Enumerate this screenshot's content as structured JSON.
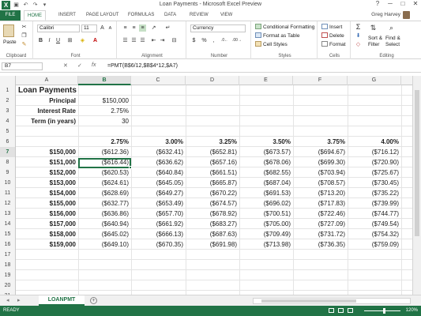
{
  "window": {
    "title": "Loan Payments - Microsoft Excel Preview",
    "user": "Greg Harvey",
    "controls": [
      "?",
      "─",
      "□",
      "✕"
    ]
  },
  "qat": {
    "logo": "X",
    "icons": [
      "save-icon",
      "undo-icon",
      "redo-icon",
      "customize-icon"
    ],
    "glyphs": [
      "▣",
      "↶",
      "↷",
      "▾"
    ]
  },
  "tabs": [
    "FILE",
    "HOME",
    "INSERT",
    "PAGE LAYOUT",
    "FORMULAS",
    "DATA",
    "REVIEW",
    "VIEW"
  ],
  "ribbon": {
    "clipboard": {
      "label": "Clipboard",
      "paste": "Paste"
    },
    "font": {
      "label": "Font",
      "name": "Calibri",
      "size": "11",
      "grow": "A",
      "shrink": "A",
      "bold": "B",
      "italic": "I",
      "underline": "U"
    },
    "alignment": {
      "label": "Alignment"
    },
    "number": {
      "label": "Number",
      "format": "Currency",
      "dollar": "$",
      "percent": "%",
      "comma": ","
    },
    "styles": {
      "label": "Styles",
      "items": [
        "Conditional Formatting",
        "Format as Table",
        "Cell Styles"
      ]
    },
    "cells": {
      "label": "Cells",
      "items": [
        "Insert",
        "Delete",
        "Format"
      ]
    },
    "editing": {
      "label": "Editing",
      "sort": "Sort &",
      "filter": "Filter",
      "find": "Find &",
      "select": "Select"
    }
  },
  "formula_bar": {
    "name_box": "B7",
    "cancel": "✕",
    "enter": "✓",
    "fx": "fx",
    "formula": "=PMT(B$6/12,$B$4*12,$A7)"
  },
  "columns": [
    "A",
    "B",
    "C",
    "D",
    "E",
    "F",
    "G"
  ],
  "row_numbers": [
    "1",
    "2",
    "3",
    "4",
    "5",
    "6",
    "7",
    "8",
    "9",
    "10",
    "11",
    "12",
    "13",
    "14",
    "15",
    "16",
    "17",
    "18",
    "19",
    "20",
    "21"
  ],
  "sheet": {
    "title": "Loan Payments",
    "inputs": [
      {
        "label": "Principal",
        "value": "$150,000"
      },
      {
        "label": "Interest Rate",
        "value": "2.75%"
      },
      {
        "label": "Term (in years)",
        "value": "30"
      }
    ],
    "rates": [
      "2.75%",
      "3.00%",
      "3.25%",
      "3.50%",
      "3.75%",
      "4.00%"
    ],
    "table": [
      {
        "principal": "$150,000",
        "payments": [
          "($612.36)",
          "($632.41)",
          "($652.81)",
          "($673.57)",
          "($694.67)",
          "($716.12)"
        ]
      },
      {
        "principal": "$151,000",
        "payments": [
          "($616.44)",
          "($636.62)",
          "($657.16)",
          "($678.06)",
          "($699.30)",
          "($720.90)"
        ]
      },
      {
        "principal": "$152,000",
        "payments": [
          "($620.53)",
          "($640.84)",
          "($661.51)",
          "($682.55)",
          "($703.94)",
          "($725.67)"
        ]
      },
      {
        "principal": "$153,000",
        "payments": [
          "($624.61)",
          "($645.05)",
          "($665.87)",
          "($687.04)",
          "($708.57)",
          "($730.45)"
        ]
      },
      {
        "principal": "$154,000",
        "payments": [
          "($628.69)",
          "($649.27)",
          "($670.22)",
          "($691.53)",
          "($713.20)",
          "($735.22)"
        ]
      },
      {
        "principal": "$155,000",
        "payments": [
          "($632.77)",
          "($653.49)",
          "($674.57)",
          "($696.02)",
          "($717.83)",
          "($739.99)"
        ]
      },
      {
        "principal": "$156,000",
        "payments": [
          "($636.86)",
          "($657.70)",
          "($678.92)",
          "($700.51)",
          "($722.46)",
          "($744.77)"
        ]
      },
      {
        "principal": "$157,000",
        "payments": [
          "($640.94)",
          "($661.92)",
          "($683.27)",
          "($705.00)",
          "($727.09)",
          "($749.54)"
        ]
      },
      {
        "principal": "$158,000",
        "payments": [
          "($645.02)",
          "($666.13)",
          "($687.63)",
          "($709.49)",
          "($731.72)",
          "($754.32)"
        ]
      },
      {
        "principal": "$159,000",
        "payments": [
          "($649.10)",
          "($670.35)",
          "($691.98)",
          "($713.98)",
          "($736.35)",
          "($759.09)"
        ]
      }
    ]
  },
  "sheet_tabs": {
    "active": "LOANPMT",
    "add": "+",
    "prev": "◂",
    "next": "▸"
  },
  "status": {
    "text": "READY",
    "zoom": "120%"
  }
}
